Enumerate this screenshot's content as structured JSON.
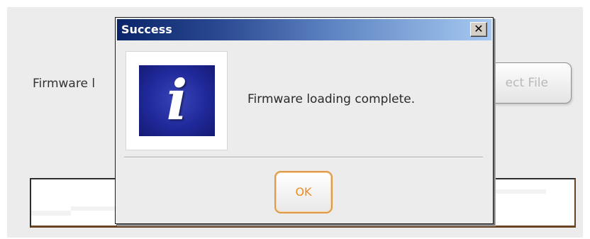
{
  "background": {
    "firmware_label": "Firmware l",
    "select_button_label": "ect File"
  },
  "dialog": {
    "title": "Success",
    "close_glyph": "✕",
    "message": "Firmware loading complete.",
    "icon": "info-icon",
    "icon_glyph": "i",
    "ok_label": "OK"
  },
  "colors": {
    "title_bar_start": "#0a246a",
    "title_bar_end": "#a6caf0",
    "ok_border": "#e09a46",
    "ok_text": "#ef8a1c"
  }
}
